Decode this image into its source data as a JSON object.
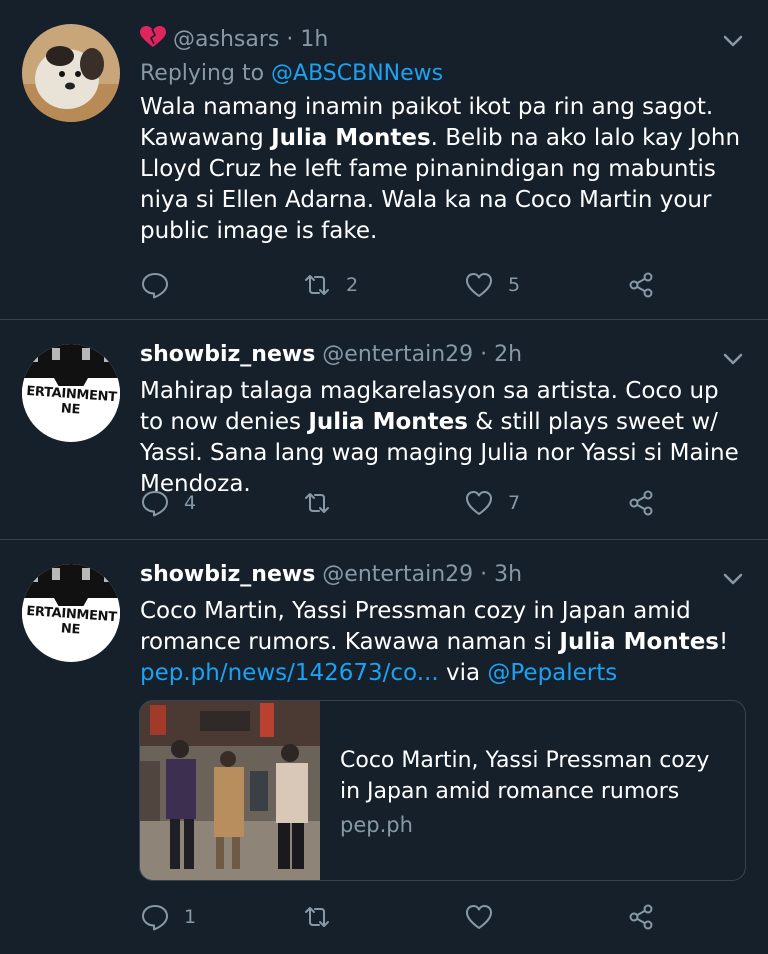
{
  "tweets": [
    {
      "emoji": "heart-icon",
      "handle": "@ashsars",
      "sep": " · ",
      "time": "1h",
      "reply_prefix": "Replying to ",
      "reply_to": "@ABSCBNNews",
      "text_a": "Wala namang inamin paikot ikot pa rin ang sagot. Kawawang ",
      "text_bold": "Julia Montes",
      "text_b": ". Belib na ako lalo kay John Lloyd Cruz  he left fame pinanindigan ng mabuntis niya si Ellen Adarna. Wala ka na Coco Martin your public image is fake.",
      "reply_count": "",
      "retweet_count": "2",
      "like_count": "5"
    },
    {
      "name": "showbiz_news",
      "handle": "@entertain29",
      "sep": " · ",
      "time": "2h",
      "text_a": "Mahirap talaga magkarelasyon sa artista. Coco up to now denies ",
      "text_bold": "Julia Montes",
      "text_b": " & still plays sweet w/ Yassi. Sana lang wag maging Julia nor Yassi si Maine Mendoza.",
      "reply_count": "4",
      "retweet_count": "",
      "like_count": "7"
    },
    {
      "name": "showbiz_news",
      "handle": "@entertain29",
      "sep": " · ",
      "time": "3h",
      "text_a": "Coco Martin, Yassi Pressman cozy in Japan amid romance rumors. Kawawa naman si ",
      "text_bold": "Julia Montes",
      "text_b": "!",
      "link": "pep.ph/news/142673/co...",
      "via": " via ",
      "via_handle": "@Pepalerts",
      "card_title": "Coco Martin, Yassi Pressman cozy in Japan amid romance rumors",
      "card_domain": "pep.ph",
      "reply_count": "1",
      "retweet_count": "",
      "like_count": ""
    }
  ],
  "avatar_badge_text": "ERTAINMENT NE",
  "colors": {
    "background": "#15202b",
    "divider": "#38444d",
    "secondary_text": "#8899a6",
    "link": "#1da1f2",
    "emoji_heart": "#e0245e"
  }
}
